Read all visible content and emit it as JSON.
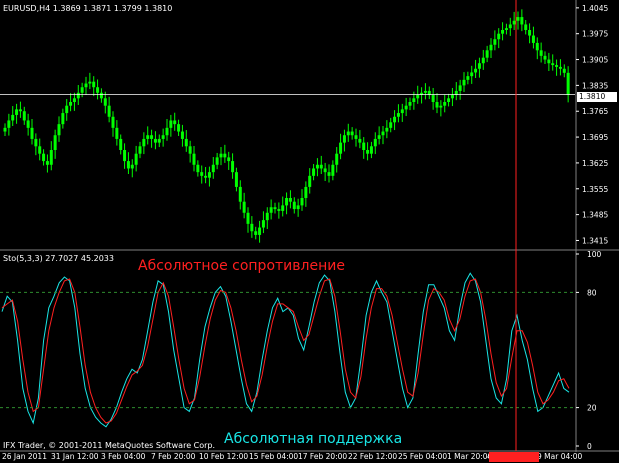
{
  "chart_data": [
    {
      "type": "candlestick",
      "title": "EURUSD,H4  1.3869 1.3871 1.3799 1.3810",
      "current_price": "1.3810",
      "ylim": [
        1.34,
        1.405
      ],
      "y_ticks": [
        "1.4045",
        "1.3975",
        "1.3905",
        "1.3835",
        "1.3765",
        "1.3695",
        "1.3625",
        "1.3555",
        "1.3485",
        "1.3415"
      ],
      "close_series": [
        1.372,
        1.374,
        1.3755,
        1.377,
        1.3765,
        1.374,
        1.372,
        1.369,
        1.367,
        1.365,
        1.363,
        1.362,
        1.366,
        1.37,
        1.373,
        1.376,
        1.378,
        1.379,
        1.38,
        1.3815,
        1.383,
        1.384,
        1.3845,
        1.383,
        1.3815,
        1.38,
        1.378,
        1.375,
        1.372,
        1.369,
        1.366,
        1.363,
        1.361,
        1.362,
        1.365,
        1.367,
        1.369,
        1.37,
        1.369,
        1.368,
        1.369,
        1.37,
        1.372,
        1.374,
        1.373,
        1.371,
        1.369,
        1.367,
        1.365,
        1.362,
        1.36,
        1.359,
        1.3585,
        1.36,
        1.362,
        1.364,
        1.365,
        1.364,
        1.363,
        1.36,
        1.356,
        1.352,
        1.349,
        1.346,
        1.344,
        1.343,
        1.345,
        1.347,
        1.349,
        1.3505,
        1.35,
        1.3495,
        1.351,
        1.353,
        1.352,
        1.35,
        1.351,
        1.353,
        1.356,
        1.359,
        1.361,
        1.362,
        1.361,
        1.36,
        1.359,
        1.362,
        1.365,
        1.368,
        1.37,
        1.371,
        1.37,
        1.369,
        1.368,
        1.366,
        1.365,
        1.367,
        1.369,
        1.37,
        1.371,
        1.372,
        1.3735,
        1.375,
        1.376,
        1.377,
        1.378,
        1.379,
        1.38,
        1.381,
        1.3815,
        1.382,
        1.381,
        1.379,
        1.3775,
        1.378,
        1.379,
        1.38,
        1.381,
        1.382,
        1.3835,
        1.385,
        1.386,
        1.387,
        1.388,
        1.3895,
        1.391,
        1.393,
        1.3945,
        1.396,
        1.3975,
        1.3985,
        1.399,
        1.4,
        1.401,
        1.402,
        1.4,
        1.3985,
        1.397,
        1.395,
        1.393,
        1.3915,
        1.3905,
        1.3895,
        1.389,
        1.3885,
        1.388,
        1.3869,
        1.381
      ]
    },
    {
      "type": "line",
      "title": "Sto(5,3,3) 27.7027 45.2033",
      "ylim": [
        0,
        100
      ],
      "y_ticks": [
        "100",
        "80",
        "20",
        "0"
      ],
      "levels": [
        80,
        20
      ],
      "series": [
        {
          "name": "main",
          "color": "#19e6e6",
          "values": [
            70,
            78,
            75,
            55,
            30,
            18,
            12,
            25,
            55,
            72,
            78,
            85,
            88,
            86,
            72,
            48,
            30,
            20,
            15,
            12,
            10,
            14,
            20,
            28,
            35,
            40,
            38,
            45,
            60,
            75,
            86,
            84,
            70,
            50,
            35,
            20,
            18,
            25,
            45,
            62,
            72,
            80,
            83,
            78,
            65,
            50,
            35,
            22,
            18,
            28,
            45,
            60,
            72,
            77,
            70,
            72,
            68,
            56,
            50,
            62,
            75,
            85,
            89,
            86,
            70,
            48,
            28,
            20,
            25,
            45,
            68,
            80,
            86,
            80,
            75,
            60,
            45,
            30,
            20,
            25,
            48,
            70,
            84,
            84,
            78,
            72,
            60,
            55,
            72,
            85,
            90,
            86,
            75,
            55,
            35,
            25,
            22,
            35,
            60,
            68,
            55,
            45,
            30,
            18,
            20,
            26,
            32,
            38,
            30,
            28
          ]
        },
        {
          "name": "signal",
          "color": "#ff2020",
          "values": [
            72,
            74,
            76,
            65,
            45,
            28,
            18,
            20,
            40,
            60,
            72,
            80,
            86,
            87,
            80,
            62,
            42,
            28,
            20,
            15,
            12,
            13,
            17,
            24,
            31,
            37,
            39,
            42,
            52,
            66,
            80,
            85,
            78,
            62,
            45,
            30,
            22,
            24,
            36,
            52,
            66,
            76,
            81,
            80,
            72,
            60,
            45,
            32,
            23,
            26,
            37,
            52,
            65,
            74,
            74,
            72,
            70,
            62,
            55,
            58,
            68,
            78,
            86,
            87,
            78,
            60,
            40,
            28,
            25,
            36,
            56,
            72,
            82,
            82,
            78,
            68,
            54,
            40,
            28,
            26,
            38,
            58,
            76,
            82,
            80,
            76,
            66,
            60,
            66,
            78,
            86,
            87,
            80,
            66,
            48,
            33,
            26,
            30,
            46,
            60,
            60,
            54,
            42,
            28,
            22,
            24,
            28,
            34,
            35,
            30
          ]
        }
      ]
    }
  ],
  "header": {
    "symbol_info": "EURUSD,H4  1.3869 1.3871 1.3799 1.3810",
    "indicator_info": "Sto(5,3,3) 27.7027 45.2033"
  },
  "annotations": {
    "resistance": "Абсолютное сопротивление",
    "support": "Абсолютная поддержка"
  },
  "copyright": "IFX Trader, © 2001-2011 MetaQuotes Software Corp.",
  "x_axis_labels": [
    "26 Jan 2011",
    "31 Jan 12:00",
    "3 Feb 04:00",
    "7 Feb 20:00",
    "10 Feb 12:00",
    "15 Feb 04:00",
    "17 Feb 20:00",
    "22 Feb 12:00",
    "25 Feb 04:00",
    "1 Mar 20:00",
    "4 Mar 12:00",
    "9 Mar 04:00"
  ],
  "colors": {
    "background": "#000000",
    "candle": "#00ff00",
    "stoch_main": "#19e6e6",
    "stoch_signal": "#ff2020",
    "level_line": "#2e8b2e",
    "vline": "#ff2020",
    "separator": "#808080"
  }
}
